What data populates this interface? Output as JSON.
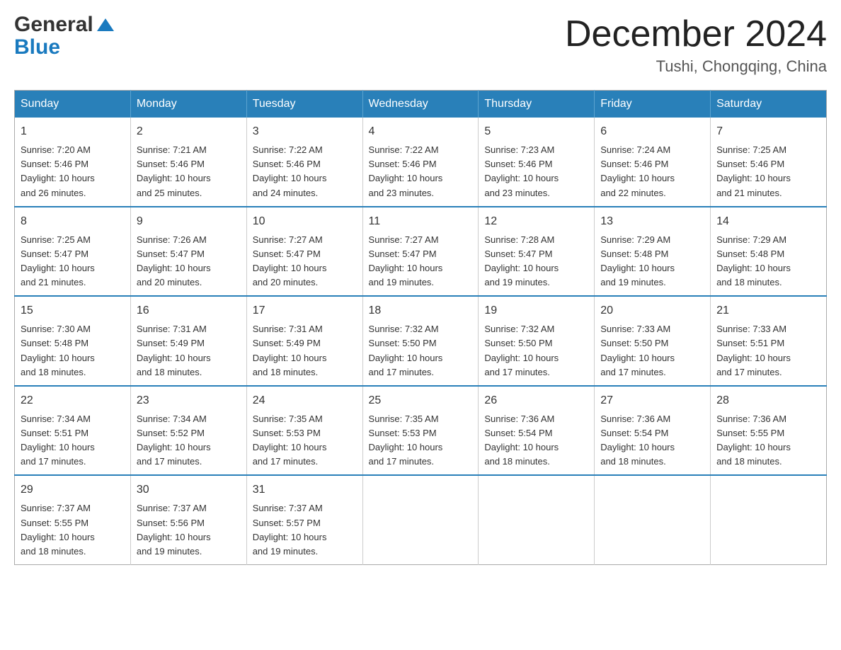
{
  "header": {
    "logo_general": "General",
    "logo_blue": "Blue",
    "month_year": "December 2024",
    "location": "Tushi, Chongqing, China"
  },
  "days_of_week": [
    "Sunday",
    "Monday",
    "Tuesday",
    "Wednesday",
    "Thursday",
    "Friday",
    "Saturday"
  ],
  "weeks": [
    [
      {
        "day": "1",
        "sunrise": "7:20 AM",
        "sunset": "5:46 PM",
        "daylight": "10 hours and 26 minutes."
      },
      {
        "day": "2",
        "sunrise": "7:21 AM",
        "sunset": "5:46 PM",
        "daylight": "10 hours and 25 minutes."
      },
      {
        "day": "3",
        "sunrise": "7:22 AM",
        "sunset": "5:46 PM",
        "daylight": "10 hours and 24 minutes."
      },
      {
        "day": "4",
        "sunrise": "7:22 AM",
        "sunset": "5:46 PM",
        "daylight": "10 hours and 23 minutes."
      },
      {
        "day": "5",
        "sunrise": "7:23 AM",
        "sunset": "5:46 PM",
        "daylight": "10 hours and 23 minutes."
      },
      {
        "day": "6",
        "sunrise": "7:24 AM",
        "sunset": "5:46 PM",
        "daylight": "10 hours and 22 minutes."
      },
      {
        "day": "7",
        "sunrise": "7:25 AM",
        "sunset": "5:46 PM",
        "daylight": "10 hours and 21 minutes."
      }
    ],
    [
      {
        "day": "8",
        "sunrise": "7:25 AM",
        "sunset": "5:47 PM",
        "daylight": "10 hours and 21 minutes."
      },
      {
        "day": "9",
        "sunrise": "7:26 AM",
        "sunset": "5:47 PM",
        "daylight": "10 hours and 20 minutes."
      },
      {
        "day": "10",
        "sunrise": "7:27 AM",
        "sunset": "5:47 PM",
        "daylight": "10 hours and 20 minutes."
      },
      {
        "day": "11",
        "sunrise": "7:27 AM",
        "sunset": "5:47 PM",
        "daylight": "10 hours and 19 minutes."
      },
      {
        "day": "12",
        "sunrise": "7:28 AM",
        "sunset": "5:47 PM",
        "daylight": "10 hours and 19 minutes."
      },
      {
        "day": "13",
        "sunrise": "7:29 AM",
        "sunset": "5:48 PM",
        "daylight": "10 hours and 19 minutes."
      },
      {
        "day": "14",
        "sunrise": "7:29 AM",
        "sunset": "5:48 PM",
        "daylight": "10 hours and 18 minutes."
      }
    ],
    [
      {
        "day": "15",
        "sunrise": "7:30 AM",
        "sunset": "5:48 PM",
        "daylight": "10 hours and 18 minutes."
      },
      {
        "day": "16",
        "sunrise": "7:31 AM",
        "sunset": "5:49 PM",
        "daylight": "10 hours and 18 minutes."
      },
      {
        "day": "17",
        "sunrise": "7:31 AM",
        "sunset": "5:49 PM",
        "daylight": "10 hours and 18 minutes."
      },
      {
        "day": "18",
        "sunrise": "7:32 AM",
        "sunset": "5:50 PM",
        "daylight": "10 hours and 17 minutes."
      },
      {
        "day": "19",
        "sunrise": "7:32 AM",
        "sunset": "5:50 PM",
        "daylight": "10 hours and 17 minutes."
      },
      {
        "day": "20",
        "sunrise": "7:33 AM",
        "sunset": "5:50 PM",
        "daylight": "10 hours and 17 minutes."
      },
      {
        "day": "21",
        "sunrise": "7:33 AM",
        "sunset": "5:51 PM",
        "daylight": "10 hours and 17 minutes."
      }
    ],
    [
      {
        "day": "22",
        "sunrise": "7:34 AM",
        "sunset": "5:51 PM",
        "daylight": "10 hours and 17 minutes."
      },
      {
        "day": "23",
        "sunrise": "7:34 AM",
        "sunset": "5:52 PM",
        "daylight": "10 hours and 17 minutes."
      },
      {
        "day": "24",
        "sunrise": "7:35 AM",
        "sunset": "5:53 PM",
        "daylight": "10 hours and 17 minutes."
      },
      {
        "day": "25",
        "sunrise": "7:35 AM",
        "sunset": "5:53 PM",
        "daylight": "10 hours and 17 minutes."
      },
      {
        "day": "26",
        "sunrise": "7:36 AM",
        "sunset": "5:54 PM",
        "daylight": "10 hours and 18 minutes."
      },
      {
        "day": "27",
        "sunrise": "7:36 AM",
        "sunset": "5:54 PM",
        "daylight": "10 hours and 18 minutes."
      },
      {
        "day": "28",
        "sunrise": "7:36 AM",
        "sunset": "5:55 PM",
        "daylight": "10 hours and 18 minutes."
      }
    ],
    [
      {
        "day": "29",
        "sunrise": "7:37 AM",
        "sunset": "5:55 PM",
        "daylight": "10 hours and 18 minutes."
      },
      {
        "day": "30",
        "sunrise": "7:37 AM",
        "sunset": "5:56 PM",
        "daylight": "10 hours and 19 minutes."
      },
      {
        "day": "31",
        "sunrise": "7:37 AM",
        "sunset": "5:57 PM",
        "daylight": "10 hours and 19 minutes."
      },
      null,
      null,
      null,
      null
    ]
  ],
  "labels": {
    "sunrise": "Sunrise:",
    "sunset": "Sunset:",
    "daylight": "Daylight:"
  }
}
